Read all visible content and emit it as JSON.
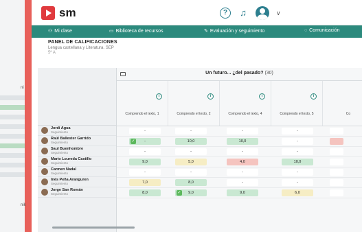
{
  "app": {
    "logo_text": "sm"
  },
  "nav": {
    "items": [
      {
        "label": "Mi clase",
        "icon": "users-icon"
      },
      {
        "label": "Biblioteca de recursos",
        "icon": "folder-icon"
      },
      {
        "label": "Evaluación y seguimiento",
        "icon": "edit-icon"
      },
      {
        "label": "Comunicación",
        "icon": "chat-icon"
      }
    ]
  },
  "page": {
    "title": "PANEL DE CALIFICACIONES",
    "subject": "Lengua castellana y Literatura. SEP",
    "group": "5º A"
  },
  "unit": {
    "title": "Un futuro... ¿del pasado?",
    "count": "(30)"
  },
  "columns": [
    "Comprendo el texto, 1",
    "Comprendo el texto, 2",
    "Comprendo el texto, 4",
    "Comprendo el texto, 5",
    "Co"
  ],
  "students": [
    {
      "name": "Jordi Agua",
      "status": "Seguimiento"
    },
    {
      "name": "Raúl Ballester Garrido",
      "status": "Seguimiento"
    },
    {
      "name": "Saul Buenhombre",
      "status": "Seguimiento"
    },
    {
      "name": "Mario Loureda Castillo",
      "status": "Seguimiento"
    },
    {
      "name": "Carmen Nadal",
      "status": "Seguimiento"
    },
    {
      "name": "Inés Peña Aranguren",
      "status": "Seguimiento"
    },
    {
      "name": "Jorge San Román",
      "status": "Seguimiento"
    }
  ],
  "grades": [
    [
      "-",
      "-",
      "-",
      "-",
      ""
    ],
    [
      "-",
      "10,0",
      "10,0",
      "-",
      ""
    ],
    [
      "-",
      "-",
      "-",
      "-",
      ""
    ],
    [
      "9,0",
      "5,0",
      "4,0",
      "10,0",
      ""
    ],
    [
      "-",
      "-",
      "-",
      "-",
      ""
    ],
    [
      "7,0",
      "8,0",
      "-",
      "-",
      ""
    ],
    [
      "8,0",
      "9,0",
      "9,0",
      "6,0",
      ""
    ]
  ],
  "bg_window": {
    "labels": [
      "ni",
      "nik"
    ]
  }
}
